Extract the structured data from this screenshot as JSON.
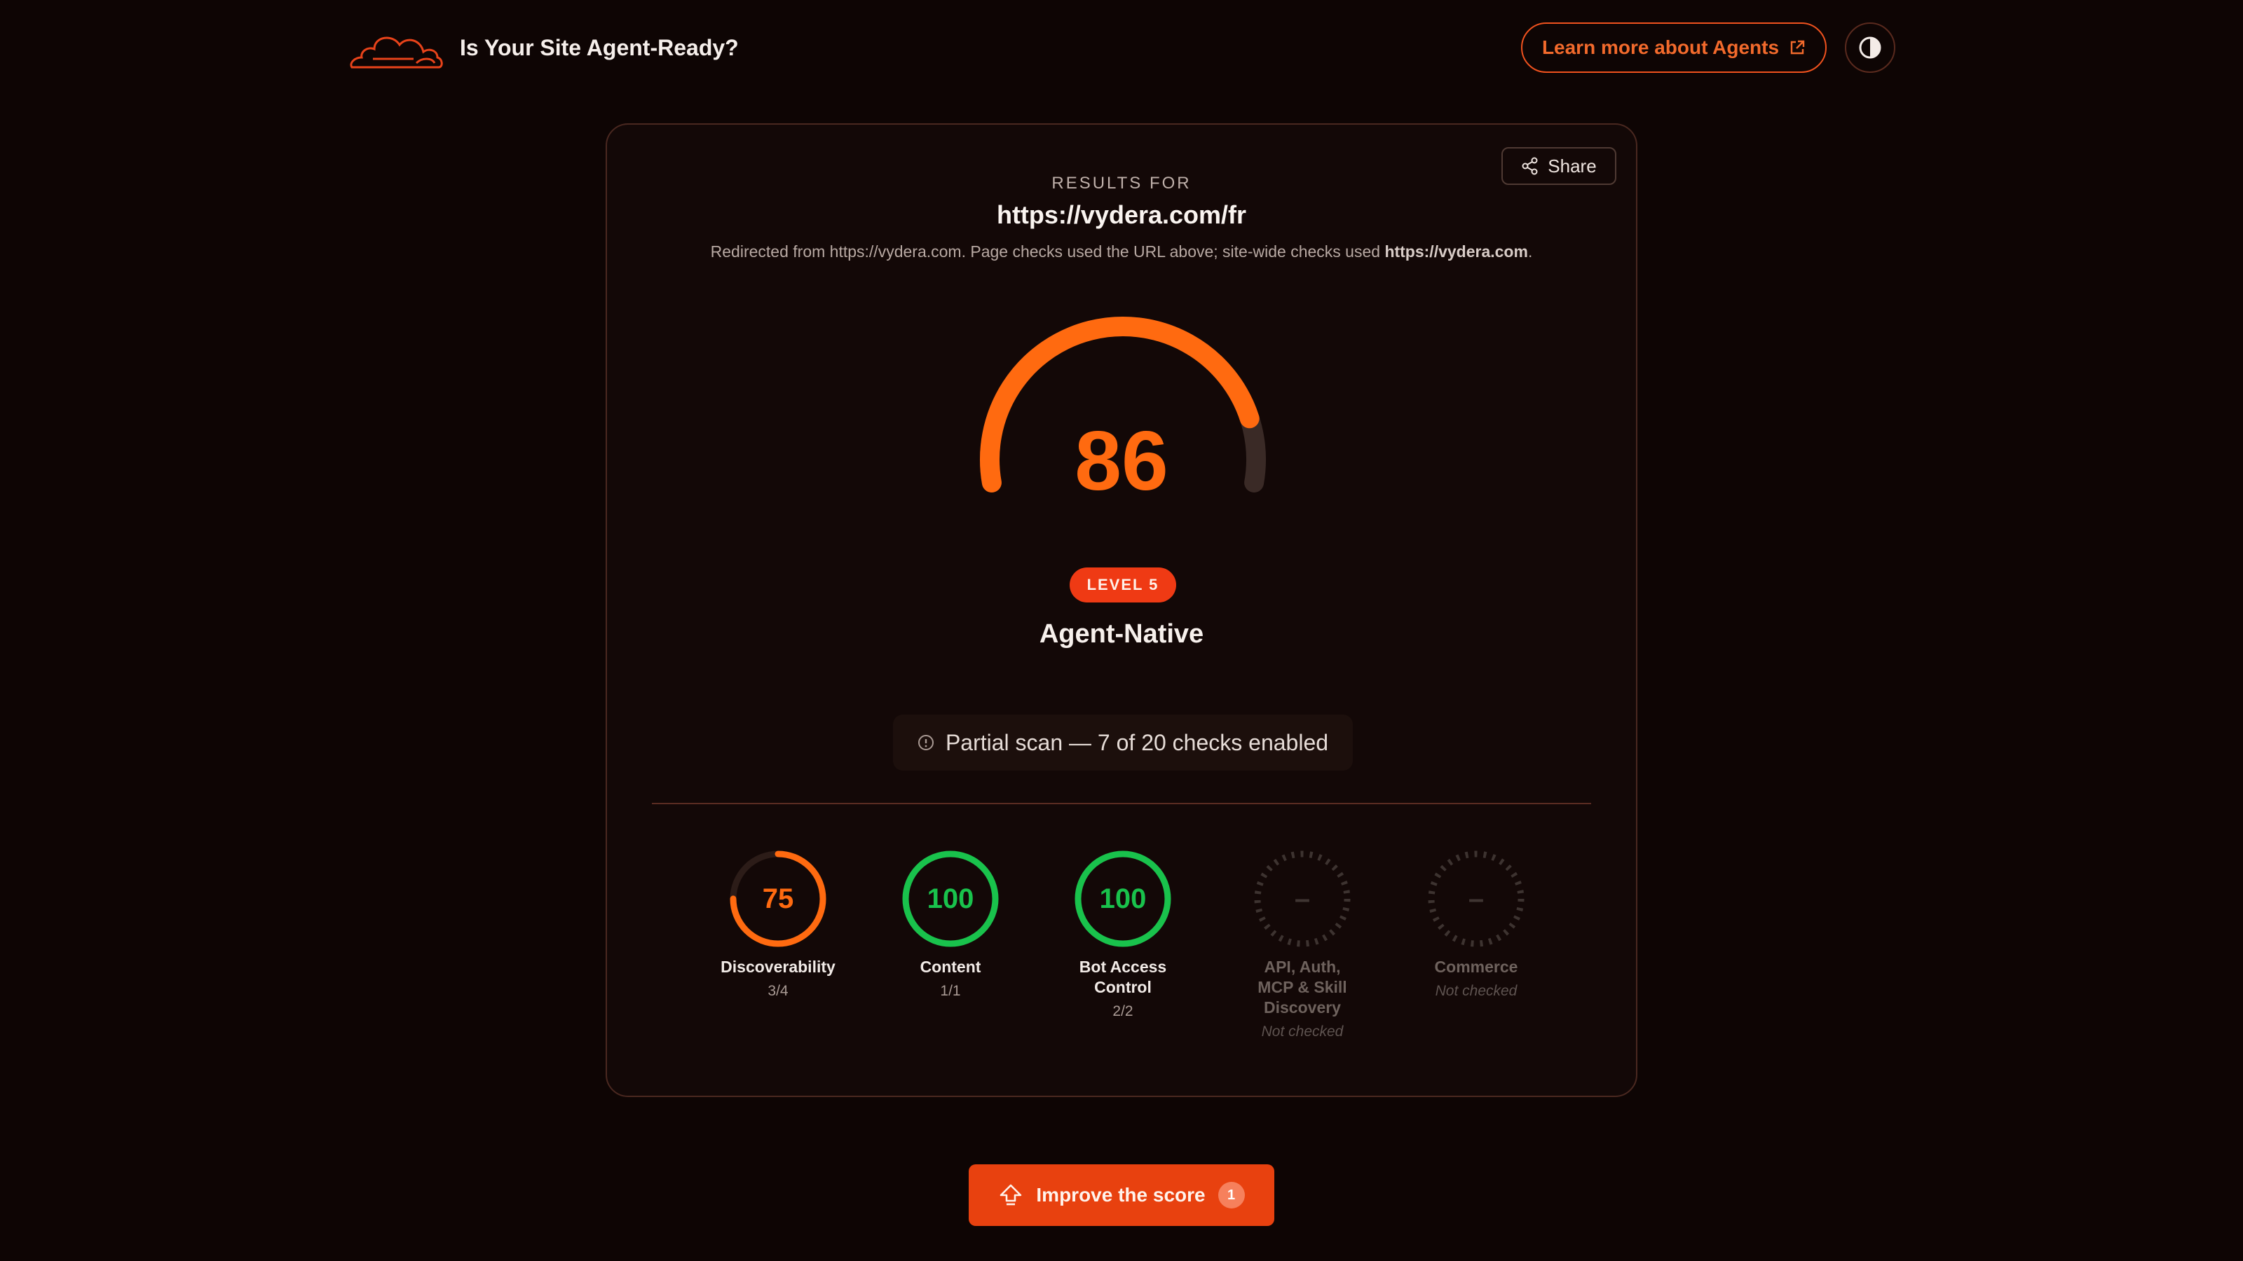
{
  "header": {
    "site_title": "Is Your Site Agent-Ready?",
    "learn_more_label": "Learn more about Agents"
  },
  "results": {
    "label": "RESULTS FOR",
    "url": "https://vydera.com/fr",
    "redirect_prefix": "Redirected from https://vydera.com. Page checks used the URL above; site-wide checks used ",
    "redirect_site": "https://vydera.com",
    "redirect_suffix": ".",
    "share_label": "Share"
  },
  "score": {
    "value": 86,
    "max": 100,
    "level_label": "LEVEL 5",
    "level_name": "Agent-Native"
  },
  "scan": {
    "note": "Partial scan — 7 of 20 checks enabled"
  },
  "categories": [
    {
      "name": "Discoverability",
      "score": "75",
      "value": 75,
      "sub": "3/4",
      "status": "partial"
    },
    {
      "name": "Content",
      "score": "100",
      "value": 100,
      "sub": "1/1",
      "status": "pass"
    },
    {
      "name": "Bot Access Control",
      "score": "100",
      "value": 100,
      "sub": "2/2",
      "status": "pass"
    },
    {
      "name": "API, Auth, MCP & Skill Discovery",
      "score": "–",
      "value": null,
      "sub": "Not checked",
      "status": "off"
    },
    {
      "name": "Commerce",
      "score": "–",
      "value": null,
      "sub": "Not checked",
      "status": "off"
    }
  ],
  "improve": {
    "label": "Improve the score",
    "count": "1"
  },
  "colors": {
    "accent": "#ff6a10",
    "pass": "#19c24c",
    "badge": "#ef3a14",
    "track": "#3a2a26",
    "off": "#3d3330"
  },
  "icons": {
    "logo": "cloud-outline-logo",
    "external": "external-link-icon",
    "theme": "contrast-icon",
    "share": "share-icon",
    "info": "info-icon",
    "improve": "arrow-up-icon"
  }
}
